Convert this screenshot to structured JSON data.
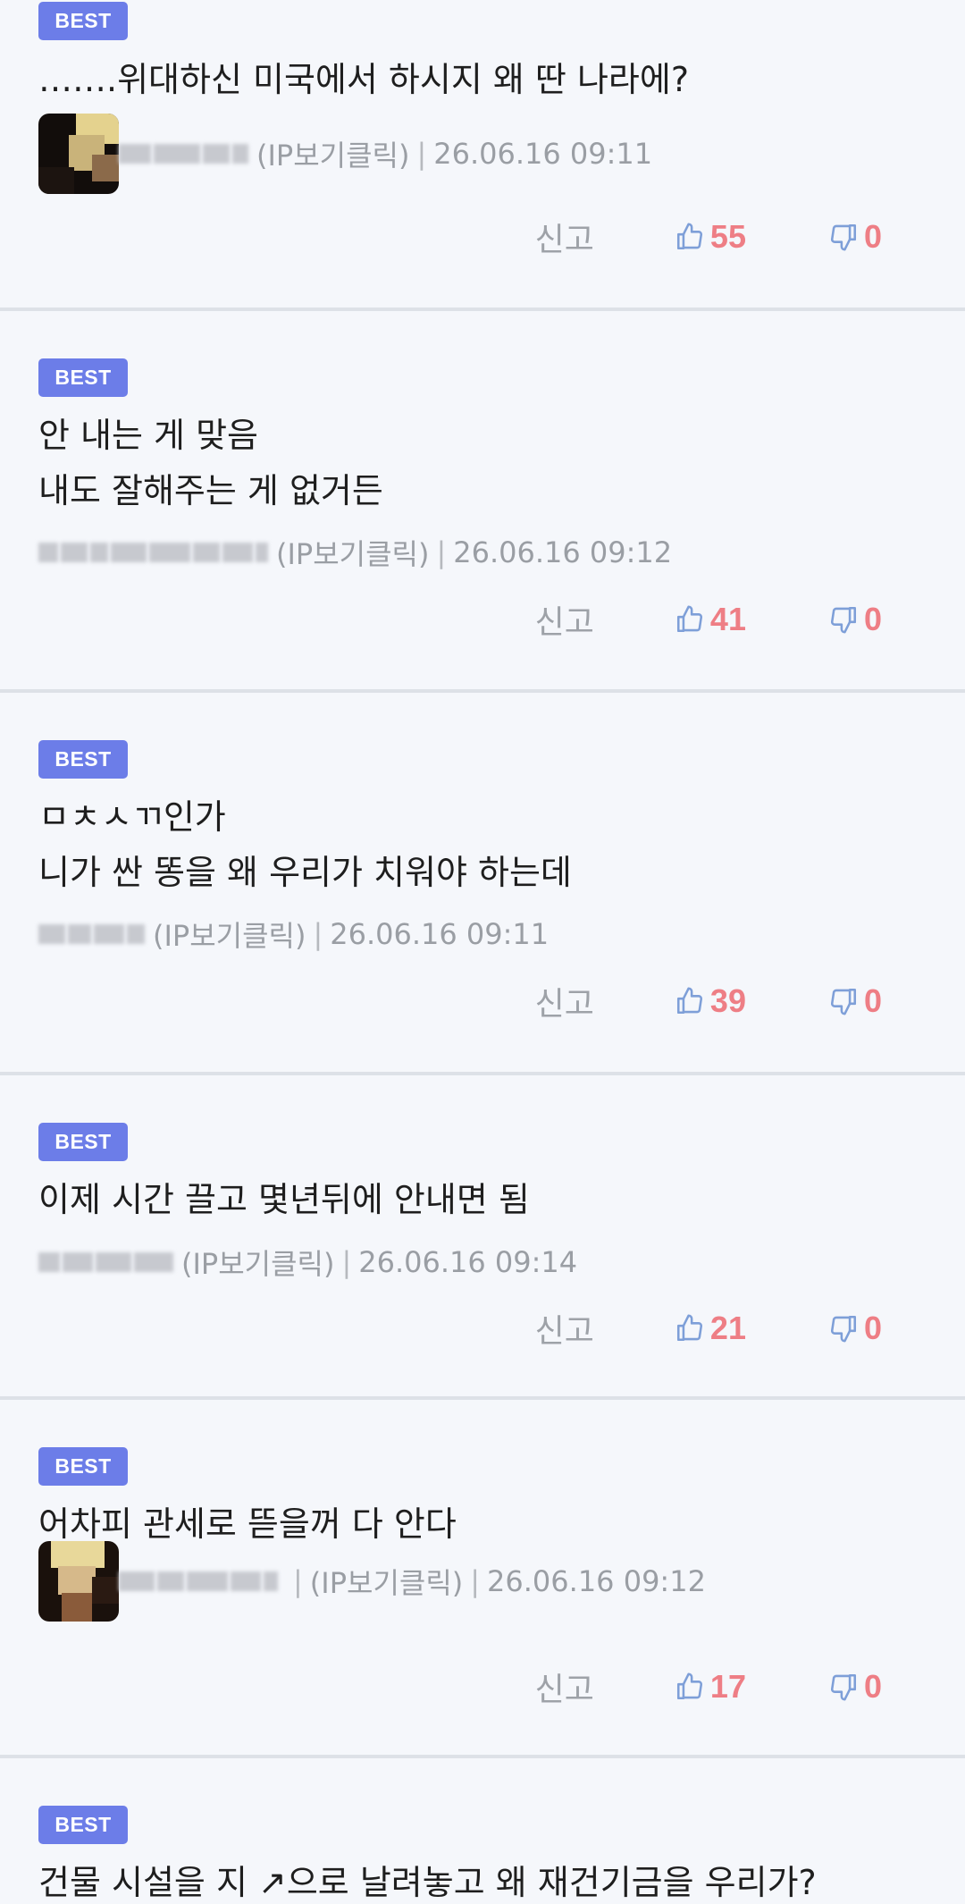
{
  "labels": {
    "best": "BEST",
    "report": "신고",
    "ip_click": "(IP보기클릭)",
    "separator": "|"
  },
  "comments": [
    {
      "lines": [
        "…….위대하신 미국에서 하시지 왜 딴 나라에?"
      ],
      "timestamp": "26.06.16 09:11",
      "likes": "55",
      "dislikes": "0"
    },
    {
      "lines": [
        "안 내는 게 맞음",
        "내도 잘해주는 게 없거든"
      ],
      "timestamp": "26.06.16 09:12",
      "likes": "41",
      "dislikes": "0"
    },
    {
      "lines": [
        "ㅁㅊㅅㄲ인가",
        "니가 싼 똥을 왜 우리가 치워야 하는데"
      ],
      "timestamp": "26.06.16 09:11",
      "likes": "39",
      "dislikes": "0"
    },
    {
      "lines": [
        "이제 시간 끌고 몇년뒤에 안내면 됨"
      ],
      "timestamp": "26.06.16 09:14",
      "likes": "21",
      "dislikes": "0"
    },
    {
      "lines": [
        "어차피 관세로 뜯을꺼 다 안다"
      ],
      "timestamp": "26.06.16 09:12",
      "likes": "17",
      "dislikes": "0"
    },
    {
      "lines": [
        "건물 시설을 지 ↗으로 날려놓고 왜 재건기금을 우리가?"
      ]
    }
  ],
  "colors": {
    "badge": "#6c7de8",
    "vote_count": "#ee7e85",
    "thumb_icon": "#7e9fd8",
    "meta_text": "#9a9ea4",
    "background": "#f5f7fb",
    "divider": "#dde1e7"
  },
  "icons": {
    "like": "thumbs-up-icon",
    "dislike": "thumbs-down-icon"
  }
}
